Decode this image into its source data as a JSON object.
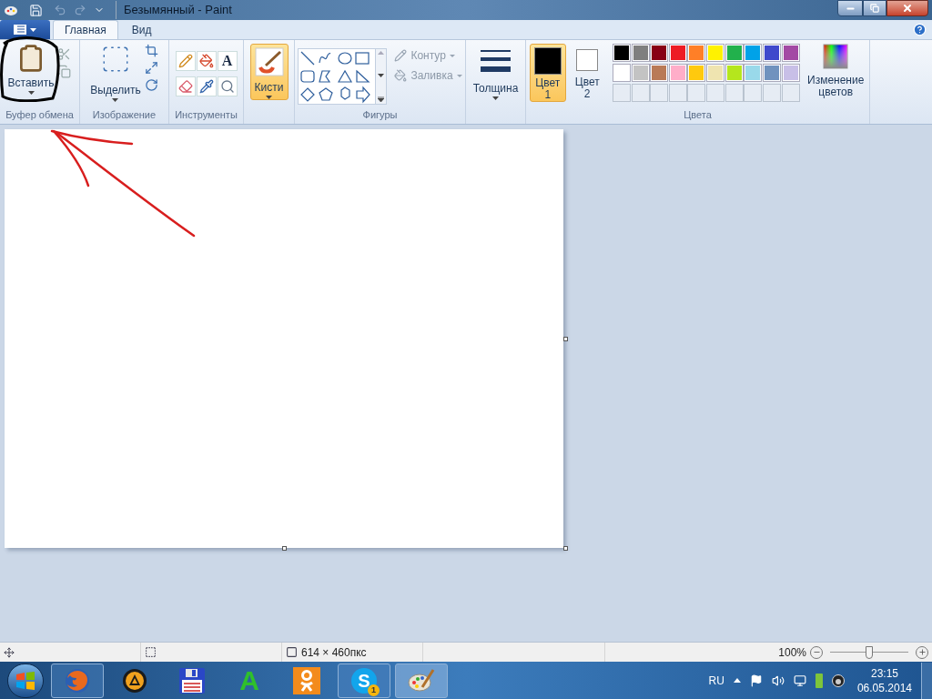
{
  "title_bar": {
    "title": "Безымянный - Paint"
  },
  "tabs": [
    {
      "label": "Главная",
      "selected": true
    },
    {
      "label": "Вид",
      "selected": false
    }
  ],
  "clipboard": {
    "label": "Буфер обмена",
    "paste": "Вставить"
  },
  "image": {
    "label": "Изображение",
    "select": "Выделить"
  },
  "tools": {
    "label": "Инструменты",
    "text_tool": "A"
  },
  "brushes": {
    "label": "Кисти",
    "selected": true
  },
  "shapes": {
    "label": "Фигуры",
    "outline": {
      "label": "Контур",
      "disabled": true
    },
    "fill": {
      "label": "Заливка",
      "disabled": true
    }
  },
  "size": {
    "label": "Толщина"
  },
  "colors": {
    "label": "Цвета",
    "color1": {
      "label": "Цвет",
      "number": "1",
      "color": "#000000",
      "selected": true
    },
    "color2": {
      "label": "Цвет",
      "number": "2",
      "color": "#ffffff",
      "selected": false
    },
    "palette": [
      {
        "color": "#000000"
      },
      {
        "color": "#7f7f7f"
      },
      {
        "color": "#880015"
      },
      {
        "color": "#ed1c24"
      },
      {
        "color": "#ff7f27"
      },
      {
        "color": "#fff200"
      },
      {
        "color": "#22b14c"
      },
      {
        "color": "#00a2e8"
      },
      {
        "color": "#3f48cc"
      },
      {
        "color": "#a349a4"
      },
      {
        "color": "#ffffff"
      },
      {
        "color": "#c3c3c3"
      },
      {
        "color": "#b97a57"
      },
      {
        "color": "#ffaec9"
      },
      {
        "color": "#ffc90e"
      },
      {
        "color": "#efe4b0"
      },
      {
        "color": "#b5e61d"
      },
      {
        "color": "#99d9ea"
      },
      {
        "color": "#7092be"
      },
      {
        "color": "#c8bfe7"
      }
    ],
    "edit": "Изменение цветов"
  },
  "status_bar": {
    "size": "614 × 460пкс",
    "zoom": "100%",
    "zoom_slider": {
      "level": 0.5
    }
  },
  "taskbar": {
    "apps": [
      {
        "kind": "firefox",
        "running": true,
        "selected": false
      },
      {
        "kind": "player",
        "running": false,
        "selected": false
      },
      {
        "kind": "floppy",
        "running": false,
        "selected": false
      },
      {
        "kind": "letter",
        "running": false,
        "selected": false,
        "glyph": "A"
      },
      {
        "kind": "social",
        "running": false,
        "selected": false
      },
      {
        "kind": "skype",
        "running": true,
        "selected": false,
        "glyph": "S",
        "badge": "1"
      },
      {
        "kind": "paint",
        "running": true,
        "selected": true
      }
    ],
    "language": "RU",
    "time": "23:15",
    "date": "06.05.2014"
  }
}
